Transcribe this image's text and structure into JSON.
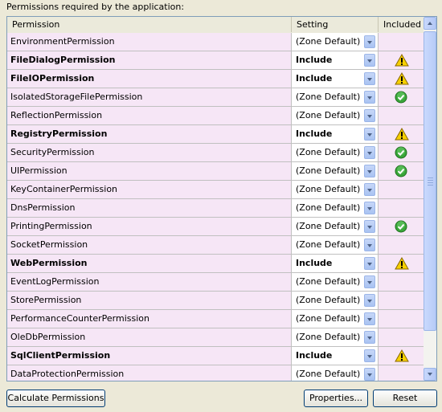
{
  "caption": "Permissions required by the application:",
  "columns": {
    "permission": "Permission",
    "setting": "Setting",
    "included": "Included"
  },
  "rows": [
    {
      "name": "EnvironmentPermission",
      "setting": "(Zone Default)",
      "bold": false,
      "status": "none"
    },
    {
      "name": "FileDialogPermission",
      "setting": "Include",
      "bold": true,
      "status": "warning"
    },
    {
      "name": "FileIOPermission",
      "setting": "Include",
      "bold": true,
      "status": "warning"
    },
    {
      "name": "IsolatedStorageFilePermission",
      "setting": "(Zone Default)",
      "bold": false,
      "status": "ok"
    },
    {
      "name": "ReflectionPermission",
      "setting": "(Zone Default)",
      "bold": false,
      "status": "none"
    },
    {
      "name": "RegistryPermission",
      "setting": "Include",
      "bold": true,
      "status": "warning"
    },
    {
      "name": "SecurityPermission",
      "setting": "(Zone Default)",
      "bold": false,
      "status": "ok"
    },
    {
      "name": "UIPermission",
      "setting": "(Zone Default)",
      "bold": false,
      "status": "ok"
    },
    {
      "name": "KeyContainerPermission",
      "setting": "(Zone Default)",
      "bold": false,
      "status": "none"
    },
    {
      "name": "DnsPermission",
      "setting": "(Zone Default)",
      "bold": false,
      "status": "none"
    },
    {
      "name": "PrintingPermission",
      "setting": "(Zone Default)",
      "bold": false,
      "status": "ok"
    },
    {
      "name": "SocketPermission",
      "setting": "(Zone Default)",
      "bold": false,
      "status": "none"
    },
    {
      "name": "WebPermission",
      "setting": "Include",
      "bold": true,
      "status": "warning"
    },
    {
      "name": "EventLogPermission",
      "setting": "(Zone Default)",
      "bold": false,
      "status": "none"
    },
    {
      "name": "StorePermission",
      "setting": "(Zone Default)",
      "bold": false,
      "status": "none"
    },
    {
      "name": "PerformanceCounterPermission",
      "setting": "(Zone Default)",
      "bold": false,
      "status": "none"
    },
    {
      "name": "OleDbPermission",
      "setting": "(Zone Default)",
      "bold": false,
      "status": "none"
    },
    {
      "name": "SqlClientPermission",
      "setting": "Include",
      "bold": true,
      "status": "warning"
    },
    {
      "name": "DataProtectionPermission",
      "setting": "(Zone Default)",
      "bold": false,
      "status": "none"
    }
  ],
  "buttons": {
    "calculate": "Calculate Permissions",
    "properties": "Properties...",
    "reset": "Reset"
  },
  "icons": {
    "warning": "warning-icon",
    "ok": "check-icon",
    "dropdown": "chevron-down-icon"
  },
  "colors": {
    "row_bg": "#f6e6f6",
    "border": "#7f9db9",
    "window_bg": "#ece9d8"
  }
}
